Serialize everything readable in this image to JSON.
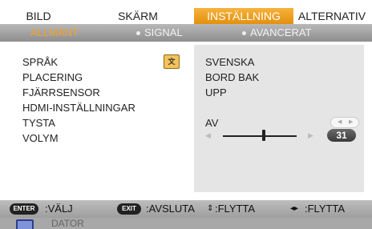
{
  "tabs": [
    "BILD",
    "SKÄRM",
    "INSTÄLLNING",
    "ALTERNATIV"
  ],
  "subtabs": [
    "ALLMÄNT",
    "SIGNAL",
    "AVANCERAT"
  ],
  "settings": {
    "labels": [
      "SPRÅK",
      "PLACERING",
      "FJÄRRSENSOR",
      "HDMI-INSTÄLLNINGAR",
      "TYSTA",
      "VOLYM"
    ],
    "values": [
      "SVENSKA",
      "BORD BAK",
      "UPP",
      "",
      "AV",
      ""
    ],
    "volume_value": "31",
    "volume_level": 0.55
  },
  "help": {
    "enter_key": "ENTER",
    "enter_label": ":VÄLJ",
    "exit_key": "EXIT",
    "exit_label": ":AVSLUTA",
    "move1_label": ":FLYTTA",
    "move2_label": ":FLYTTA"
  },
  "source": {
    "label": "DATOR"
  },
  "colors": {
    "active_tab": "#f2a22a",
    "subbar": "#a0a0a0",
    "value_panel": "#e5e5e5"
  },
  "icons": [
    "language-icon",
    "up-down-arrow-icon",
    "left-right-arrow-icon",
    "computer-source-icon"
  ]
}
